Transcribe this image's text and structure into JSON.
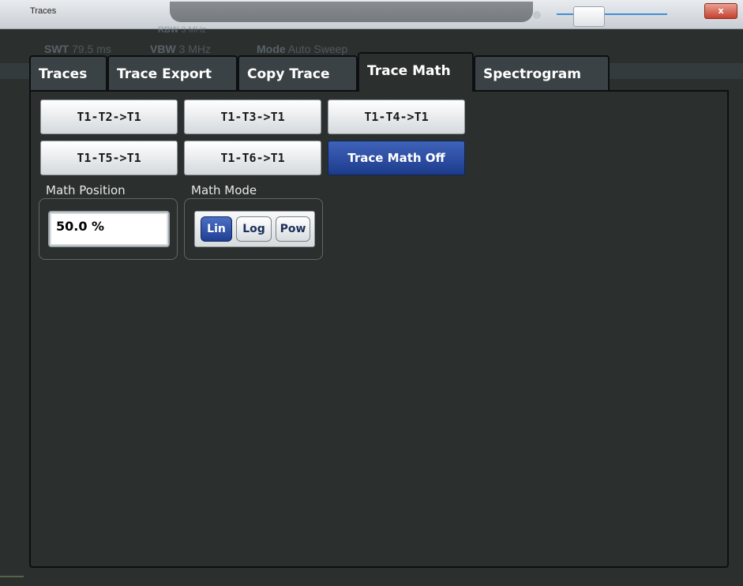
{
  "window": {
    "title": "Traces",
    "close_label": "x",
    "background_text": {
      "rbw": "RBW",
      "rbw_value": "3 MHz",
      "swt": "SWT",
      "swt_value": "79.5 ms",
      "vbw": "VBW",
      "vbw_value": "3 MHz",
      "mode": "Mode",
      "mode_value": "Auto Sweep"
    }
  },
  "tabs": [
    {
      "label": "Traces",
      "active": false
    },
    {
      "label": "Trace Export",
      "active": false
    },
    {
      "label": "Copy Trace",
      "active": false
    },
    {
      "label": "Trace Math",
      "active": true
    },
    {
      "label": "Spectrogram",
      "active": false
    }
  ],
  "trace_math": {
    "buttons": [
      {
        "label": "T1-T2->T1"
      },
      {
        "label": "T1-T3->T1"
      },
      {
        "label": "T1-T4->T1"
      },
      {
        "label": "T1-T5->T1"
      },
      {
        "label": "T1-T6->T1"
      },
      {
        "label": "Trace Math Off",
        "active": true
      }
    ],
    "math_position": {
      "label": "Math Position",
      "value": "50.0 %"
    },
    "math_mode": {
      "label": "Math Mode",
      "options": [
        "Lin",
        "Log",
        "Pow"
      ],
      "selected": "Lin"
    }
  },
  "colors": {
    "accent": "#2a4aa0",
    "trace": "#8a9a6a",
    "background": "#2b302f"
  }
}
